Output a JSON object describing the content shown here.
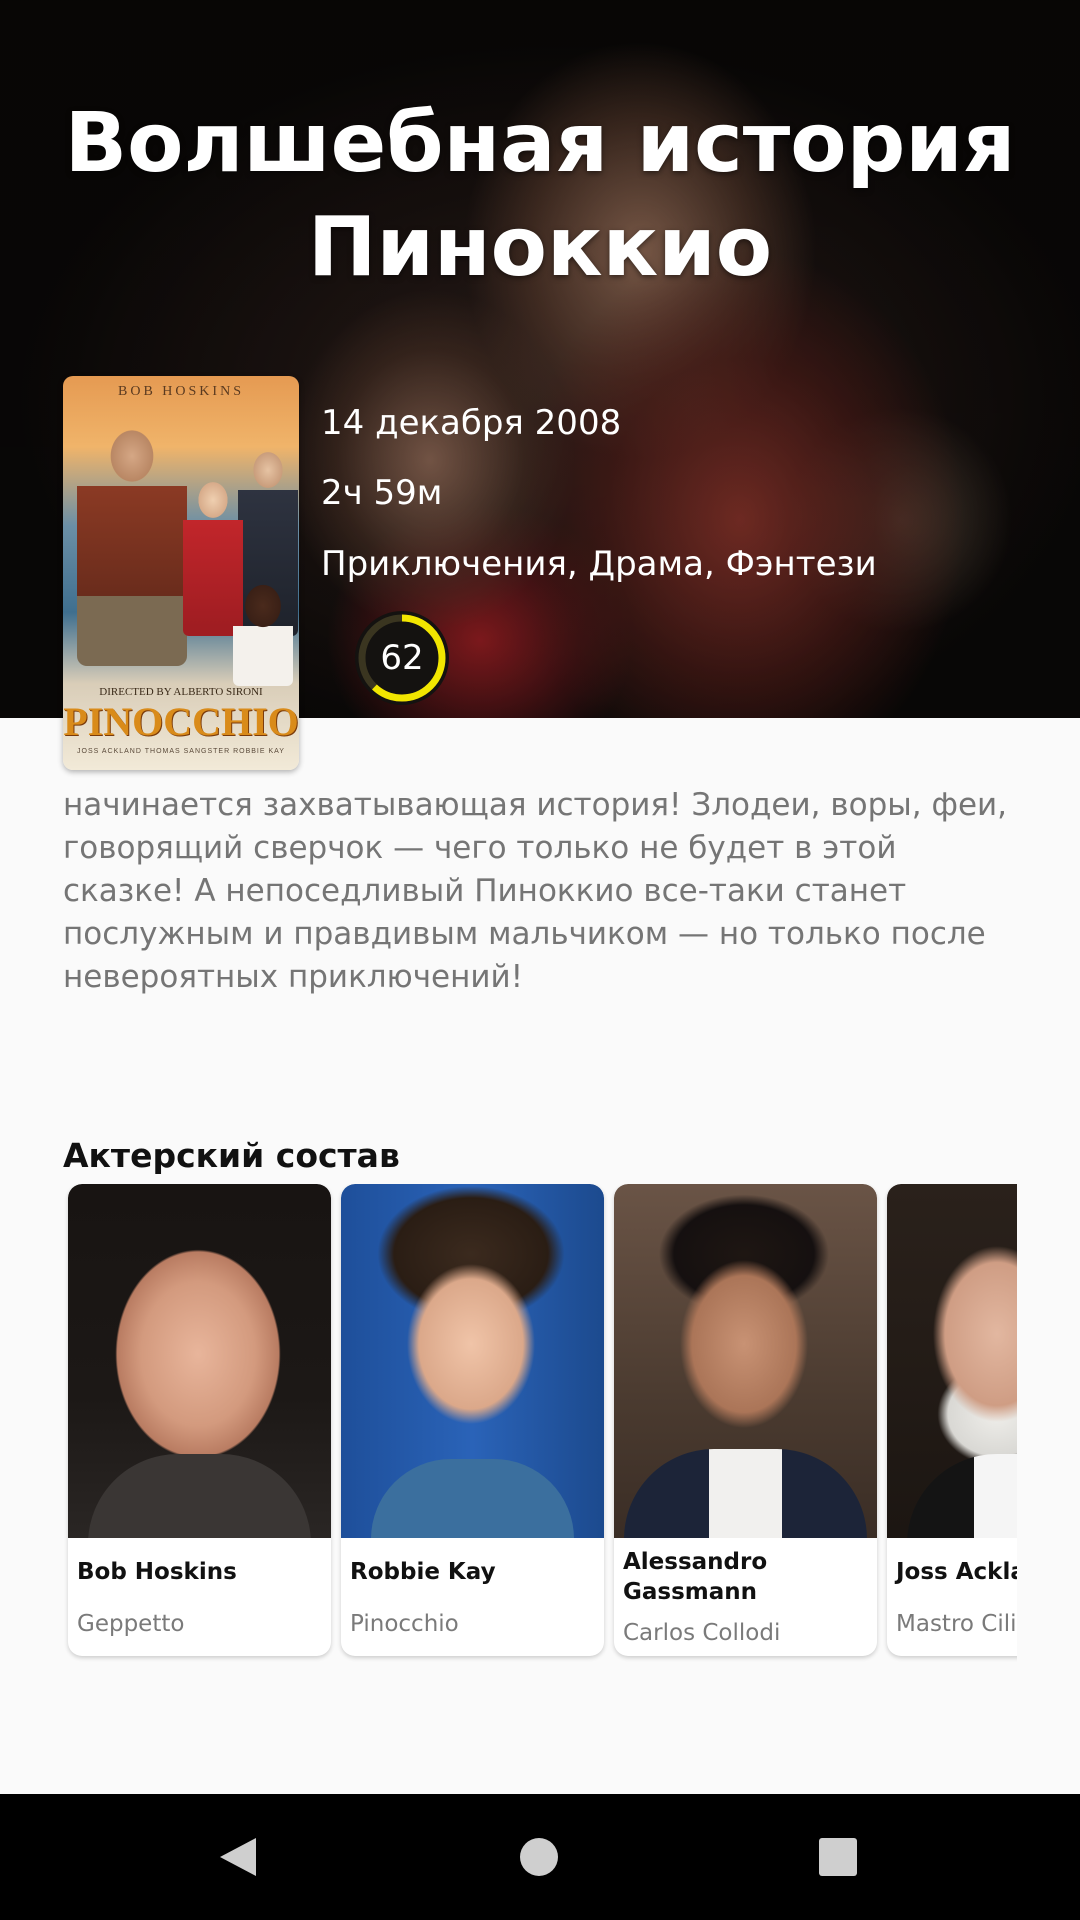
{
  "movie": {
    "title": "Волшебная история Пиноккио",
    "release_date": "14 декабря 2008",
    "runtime": "2ч 59м",
    "genres": "Приключения, Драма, Фэнтези",
    "score": 62,
    "score_color": "#f2e600",
    "overview": "начинается захватывающая история!  Злодеи, воры, феи, говорящий сверчок — чего только не будет в этой сказке! А непоседливый Пиноккио все-таки станет послужным и правдивым мальчиком — но только после невероятных приключений!"
  },
  "poster": {
    "top_text": "BOB HOSKINS",
    "director_text": "DIRECTED BY ALBERTO SIRONI",
    "logo_text": "PINOCCHIO",
    "credits_text": "JOSS ACKLAND   THOMAS SANGSTER   ROBBIE KAY"
  },
  "cast_section": {
    "title": "Актерский состав",
    "members": [
      {
        "name": "Bob Hoskins",
        "character": "Geppetto"
      },
      {
        "name": "Robbie Kay",
        "character": "Pinocchio"
      },
      {
        "name": "Alessandro Gassmann",
        "character": "Carlos Collodi"
      },
      {
        "name": "Joss Ackland",
        "character": "Mastro Ciliegia"
      }
    ]
  },
  "navbar": {
    "back_icon": "triangle-back-icon",
    "home_icon": "circle-home-icon",
    "recents_icon": "square-recents-icon"
  }
}
